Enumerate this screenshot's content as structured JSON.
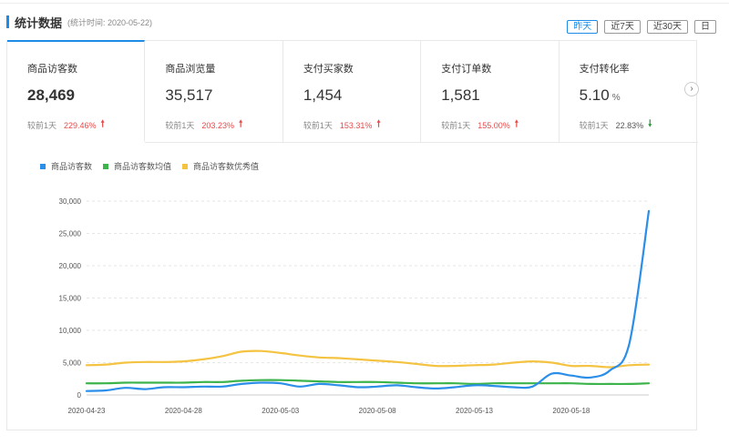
{
  "header": {
    "title": "统计数据",
    "subtitle": "(统计时间: 2020-05-22)"
  },
  "range_buttons": [
    {
      "label": "昨天",
      "active": true
    },
    {
      "label": "近7天",
      "active": false
    },
    {
      "label": "近30天",
      "active": false
    },
    {
      "label": "日",
      "active": false
    }
  ],
  "metrics": [
    {
      "label": "商品访客数",
      "value": "28,469",
      "unit": "",
      "compare_label": "较前1天",
      "change": "229.46%",
      "direction": "up"
    },
    {
      "label": "商品浏览量",
      "value": "35,517",
      "unit": "",
      "compare_label": "较前1天",
      "change": "203.23%",
      "direction": "up"
    },
    {
      "label": "支付买家数",
      "value": "1,454",
      "unit": "",
      "compare_label": "较前1天",
      "change": "153.31%",
      "direction": "up"
    },
    {
      "label": "支付订单数",
      "value": "1,581",
      "unit": "",
      "compare_label": "较前1天",
      "change": "155.00%",
      "direction": "up"
    },
    {
      "label": "支付转化率",
      "value": "5.10",
      "unit": "%",
      "compare_label": "较前1天",
      "change": "22.83%",
      "direction": "down"
    }
  ],
  "colors": {
    "accent": "#1e8ce6",
    "up": "#e84a4a",
    "down": "#2a9a3a"
  },
  "icons": {
    "up": "arrow-up-icon",
    "down": "arrow-down-icon",
    "next": "chevron-right-icon"
  },
  "chart_data": {
    "type": "line",
    "title": "",
    "xlabel": "",
    "ylabel": "",
    "ylim": [
      0,
      30000
    ],
    "yticks": [
      0,
      5000,
      10000,
      15000,
      20000,
      25000,
      30000
    ],
    "ytick_labels": [
      "0",
      "5,000",
      "10,000",
      "15,000",
      "20,000",
      "25,000",
      "30,000"
    ],
    "x": [
      "2020-04-23",
      "2020-04-24",
      "2020-04-25",
      "2020-04-26",
      "2020-04-27",
      "2020-04-28",
      "2020-04-29",
      "2020-04-30",
      "2020-05-01",
      "2020-05-02",
      "2020-05-03",
      "2020-05-04",
      "2020-05-05",
      "2020-05-06",
      "2020-05-07",
      "2020-05-08",
      "2020-05-09",
      "2020-05-10",
      "2020-05-11",
      "2020-05-12",
      "2020-05-13",
      "2020-05-14",
      "2020-05-15",
      "2020-05-16",
      "2020-05-17",
      "2020-05-18",
      "2020-05-19",
      "2020-05-20",
      "2020-05-21",
      "2020-05-22"
    ],
    "xtick_labels": [
      "2020-04-23",
      "2020-04-28",
      "2020-05-03",
      "2020-05-08",
      "2020-05-13",
      "2020-05-18"
    ],
    "xtick_index": [
      0,
      5,
      10,
      15,
      20,
      25
    ],
    "grid": true,
    "legend_position": "top-left",
    "series": [
      {
        "name": "商品访客数",
        "color": "#2b8ee8",
        "values": [
          600,
          700,
          1100,
          900,
          1200,
          1200,
          1300,
          1300,
          1700,
          1900,
          1800,
          1300,
          1700,
          1500,
          1200,
          1300,
          1500,
          1200,
          1000,
          1200,
          1500,
          1400,
          1200,
          1300,
          3300,
          3000,
          2700,
          3800,
          8000,
          28469
        ]
      },
      {
        "name": "商品访客数均值",
        "color": "#3cb44b",
        "values": [
          1800,
          1800,
          1900,
          1900,
          1900,
          1900,
          2000,
          2000,
          2200,
          2300,
          2300,
          2200,
          2100,
          2000,
          2000,
          2000,
          1900,
          1800,
          1800,
          1800,
          1700,
          1800,
          1800,
          1800,
          1800,
          1800,
          1700,
          1700,
          1700,
          1800
        ]
      },
      {
        "name": "商品访客数优秀值",
        "color": "#f5c342",
        "values": [
          4600,
          4700,
          5000,
          5100,
          5100,
          5200,
          5500,
          6000,
          6700,
          6800,
          6500,
          6100,
          5800,
          5700,
          5500,
          5300,
          5100,
          4800,
          4500,
          4500,
          4600,
          4700,
          5000,
          5200,
          5000,
          4500,
          4500,
          4300,
          4600,
          4700
        ]
      }
    ]
  }
}
